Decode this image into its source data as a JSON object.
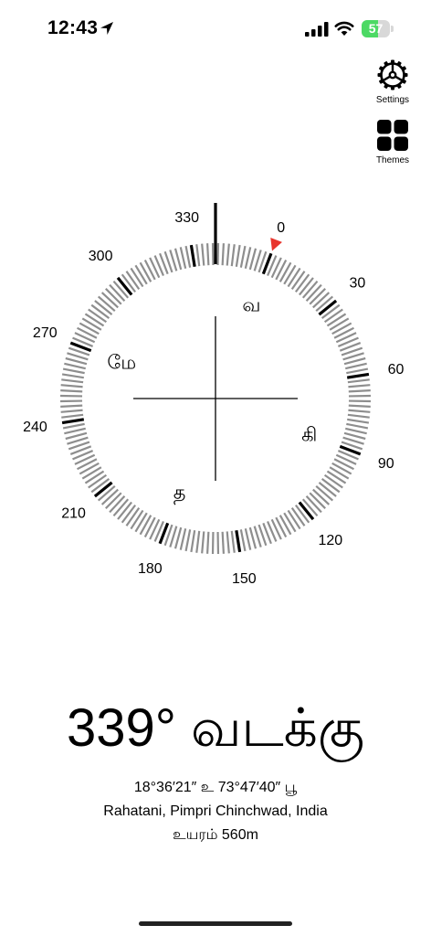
{
  "status_bar": {
    "time": "12:43",
    "battery_level": 57,
    "battery_text": "57",
    "location_icon": "location-arrow-icon",
    "signal_icon": "cellular-signal-icon",
    "wifi_icon": "wifi-icon",
    "battery_icon": "battery-charging-icon"
  },
  "toolbar": {
    "settings_label": "Settings",
    "settings_icon": "gear-icon",
    "themes_label": "Themes",
    "themes_icon": "grid-icon"
  },
  "compass": {
    "heading_degrees": 339,
    "degree_labels": [
      "0",
      "30",
      "60",
      "90",
      "120",
      "150",
      "180",
      "210",
      "240",
      "270",
      "300",
      "330"
    ],
    "cardinals": {
      "north": "வ",
      "east": "கி",
      "south": "த",
      "west": "மே"
    },
    "north_marker_color": "#e8342c"
  },
  "readout": {
    "heading_text": "339° வடக்கு",
    "coordinates": "18°36′21″ உ 73°47′40″ பூ",
    "location": "Rahatani, Pimpri Chinchwad, India",
    "altitude": "உயரம் 560m"
  }
}
